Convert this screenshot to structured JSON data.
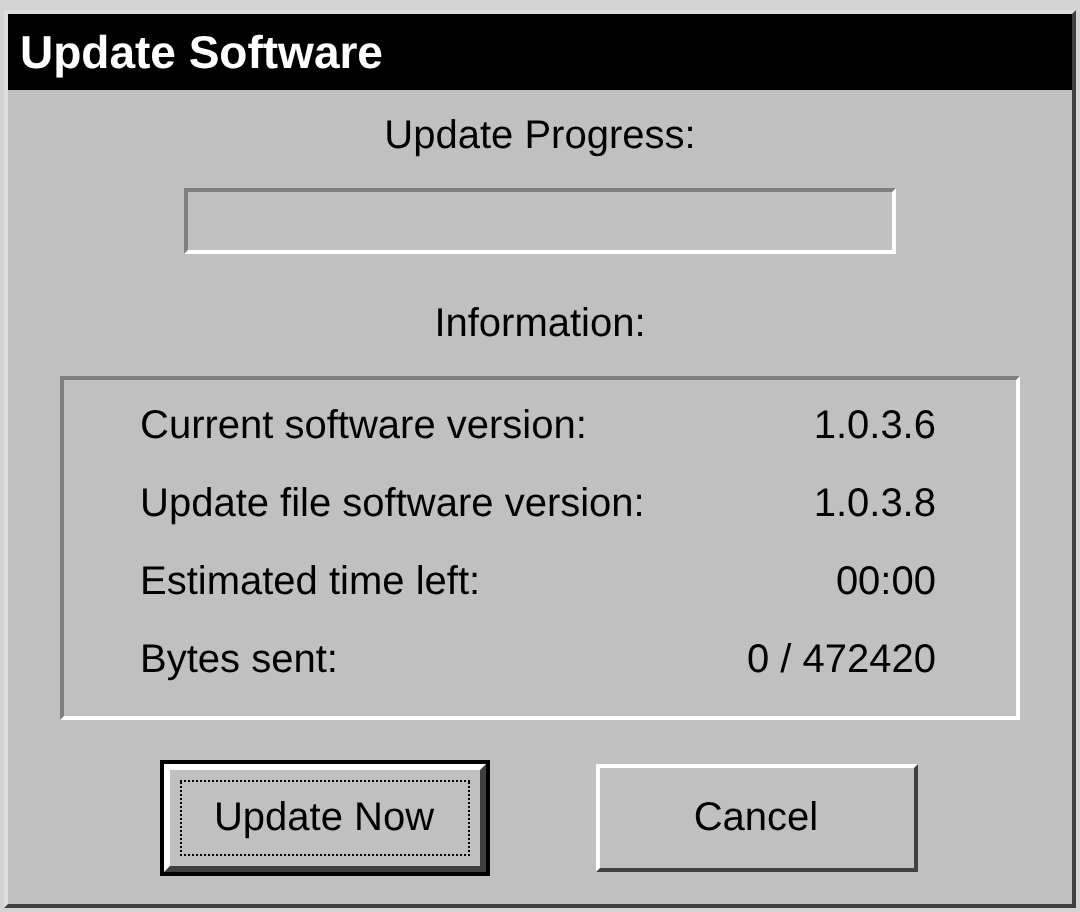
{
  "window": {
    "title": "Update Software"
  },
  "progress": {
    "label": "Update Progress:",
    "level": 0
  },
  "information": {
    "label": "Information:",
    "rows": [
      {
        "label": "Current software version:",
        "value": "1.0.3.6"
      },
      {
        "label": "Update file software version:",
        "value": "1.0.3.8"
      },
      {
        "label": "Estimated time left:",
        "value": "00:00"
      },
      {
        "label": "Bytes sent:",
        "value": "0 / 472420"
      }
    ]
  },
  "buttons": [
    {
      "label": "Update Now",
      "default": true,
      "focused": true
    },
    {
      "label": "Cancel",
      "default": false,
      "focused": false
    }
  ]
}
